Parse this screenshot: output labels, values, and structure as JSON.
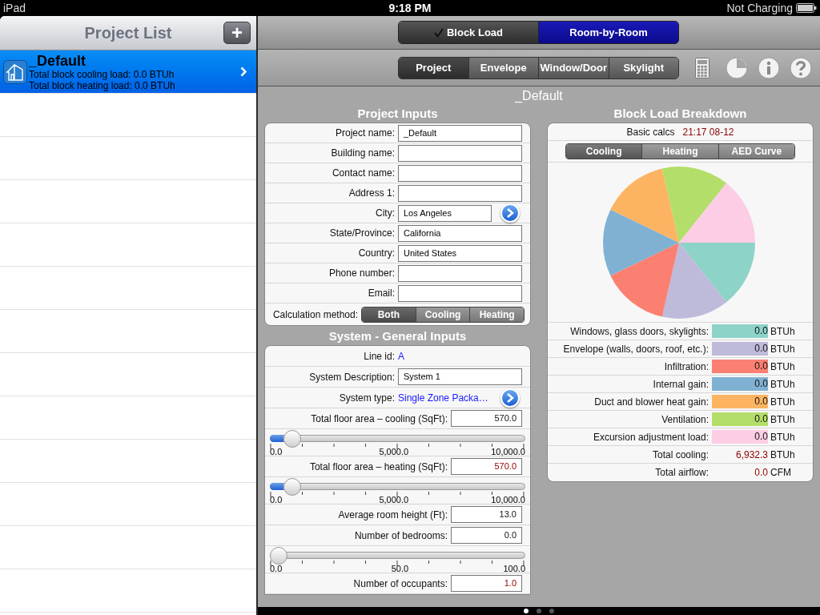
{
  "status_bar": {
    "device": "iPad",
    "time": "9:18 PM",
    "battery": "Not Charging"
  },
  "project_list": {
    "title": "Project List",
    "add_button": "+",
    "items": [
      {
        "name": "_Default",
        "cooling": "Total block cooling load: 0.0 BTUh",
        "heating": "Total block heating load: 0.0 BTUh",
        "selected": true
      }
    ]
  },
  "mode_tabs": [
    {
      "label": "Block Load",
      "checked": true,
      "selected": false
    },
    {
      "label": "Room-by-Room",
      "checked": false,
      "selected": true
    }
  ],
  "section_tabs": [
    {
      "label": "Project",
      "selected": true
    },
    {
      "label": "Envelope",
      "selected": false
    },
    {
      "label": "Window/Door",
      "selected": false
    },
    {
      "label": "Skylight",
      "selected": false
    }
  ],
  "project_title": "_Default",
  "project_inputs": {
    "title": "Project Inputs",
    "fields": [
      {
        "kind": "text",
        "label": "Project name:",
        "value": "_Default"
      },
      {
        "kind": "text",
        "label": "Building name:"
      },
      {
        "kind": "text",
        "label": "Contact name:"
      },
      {
        "kind": "text",
        "label": "Address 1:"
      },
      {
        "kind": "picker",
        "label": "City:",
        "value": "Los Angeles"
      },
      {
        "kind": "text",
        "label": "State/Province:",
        "value": "California"
      },
      {
        "kind": "text",
        "label": "Country:",
        "value": "United States"
      },
      {
        "kind": "text",
        "label": "Phone number:"
      },
      {
        "kind": "text",
        "label": "Email:"
      }
    ],
    "calc_method": {
      "label": "Calculation method:",
      "options": [
        {
          "label": "Both",
          "selected": true
        },
        {
          "label": "Cooling",
          "selected": false
        },
        {
          "label": "Heating",
          "selected": false
        }
      ]
    }
  },
  "system_inputs": {
    "title": "System - General Inputs",
    "rows": [
      {
        "kind": "info",
        "label": "Line id:",
        "value": "A"
      },
      {
        "kind": "text",
        "label": "System Description:",
        "value": "System 1"
      },
      {
        "kind": "picker",
        "label": "System type:",
        "value": "Single Zone Packa…"
      },
      {
        "kind": "number",
        "label": "Total floor area – cooling (SqFt):",
        "value": "570.0",
        "modified": false
      },
      {
        "kind": "slider",
        "level": 0.057,
        "min": "0.0",
        "mid": "5,000.0",
        "max": "10,000.0"
      },
      {
        "kind": "number",
        "label": "Total floor area – heating (SqFt):",
        "value": "570.0",
        "modified": true
      },
      {
        "kind": "slider",
        "level": 0.057,
        "min": "0.0",
        "mid": "5,000.0",
        "max": "10,000.0"
      },
      {
        "kind": "number",
        "label": "Average room height (Ft):",
        "value": "13.0",
        "modified": false
      },
      {
        "kind": "number",
        "label": "Number of bedrooms:",
        "value": "0.0",
        "modified": false
      },
      {
        "kind": "slider",
        "level": 0,
        "min": "0.0",
        "mid": "50.0",
        "max": "100.0"
      },
      {
        "kind": "number",
        "label": "Number of occupants:",
        "value": "1.0",
        "modified": true
      }
    ]
  },
  "block_load": {
    "title": "Block Load Breakdown",
    "calc_label": "Basic calcs",
    "calc_time": "21:17 08-12",
    "tabs": [
      {
        "label": "Cooling",
        "selected": true
      },
      {
        "label": "Heating",
        "selected": false
      },
      {
        "label": "AED Curve",
        "selected": false
      }
    ],
    "loads": [
      {
        "label": "Windows, glass doors, skylights:",
        "value": "0.0",
        "unit": "BTUh",
        "color": "#8dd3c7"
      },
      {
        "label": "Envelope (walls, doors, roof, etc.):",
        "value": "0.0",
        "unit": "BTUh",
        "color": "#bebada"
      },
      {
        "label": "Infiltration:",
        "value": "0.0",
        "unit": "BTUh",
        "color": "#fb8072"
      },
      {
        "label": "Internal gain:",
        "value": "0.0",
        "unit": "BTUh",
        "color": "#80b1d3"
      },
      {
        "label": "Duct and blower heat gain:",
        "value": "0.0",
        "unit": "BTUh",
        "color": "#fdb462"
      },
      {
        "label": "Ventilation:",
        "value": "0.0",
        "unit": "BTUh",
        "color": "#b3de69"
      },
      {
        "label": "Excursion adjustment load:",
        "value": "0.0",
        "unit": "BTUh",
        "color": "#fccde5"
      }
    ],
    "totals": [
      {
        "label": "Total cooling:",
        "value": "6,932.3",
        "unit": "BTUh"
      },
      {
        "label": "Total airflow:",
        "value": "0.0",
        "unit": "CFM"
      }
    ]
  },
  "page_indicator": [
    {
      "selected": true
    },
    {
      "selected": false
    },
    {
      "selected": false
    }
  ]
}
